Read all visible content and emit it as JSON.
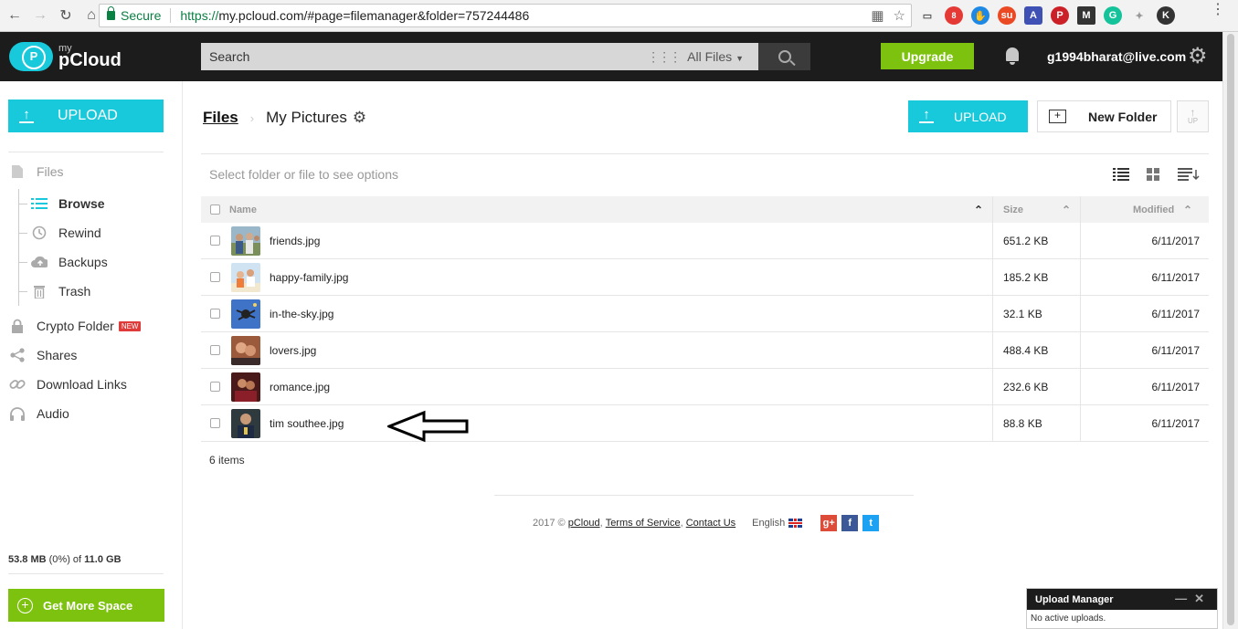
{
  "browser": {
    "secure_label": "Secure",
    "url_scheme": "https://",
    "url_rest": "my.pcloud.com/#page=filemanager&folder=757244486",
    "extension_badge": "8"
  },
  "header": {
    "logo_my": "my",
    "logo_name": "pCloud",
    "search_placeholder": "Search",
    "search_scope": "All Files",
    "upgrade_label": "Upgrade",
    "user_email": "g1994bharat@live.com"
  },
  "sidebar": {
    "upload_label": "UPLOAD",
    "files_label": "Files",
    "sub_items": [
      {
        "label": "Browse",
        "icon": "list-icon"
      },
      {
        "label": "Rewind",
        "icon": "history-icon"
      },
      {
        "label": "Backups",
        "icon": "cloud-upload-icon"
      },
      {
        "label": "Trash",
        "icon": "trash-icon"
      }
    ],
    "items": [
      {
        "label": "Crypto Folder",
        "icon": "lock-icon",
        "badge": "NEW"
      },
      {
        "label": "Shares",
        "icon": "share-icon"
      },
      {
        "label": "Download Links",
        "icon": "link-icon"
      },
      {
        "label": "Audio",
        "icon": "headphones-icon"
      }
    ],
    "storage_used": "53.8 MB",
    "storage_pct": " (0%) of ",
    "storage_total": "11.0 GB",
    "more_space_label": "Get More Space"
  },
  "main": {
    "breadcrumb_root": "Files",
    "breadcrumb_folder": "My Pictures",
    "upload_label": "UPLOAD",
    "new_folder_label": "New Folder",
    "up_label": "UP",
    "hint": "Select folder or file to see options",
    "columns": {
      "name": "Name",
      "size": "Size",
      "modified": "Modified"
    },
    "files": [
      {
        "name": "friends.jpg",
        "size": "651.2 KB",
        "modified": "6/11/2017"
      },
      {
        "name": "happy-family.jpg",
        "size": "185.2 KB",
        "modified": "6/11/2017"
      },
      {
        "name": "in-the-sky.jpg",
        "size": "32.1 KB",
        "modified": "6/11/2017"
      },
      {
        "name": "lovers.jpg",
        "size": "488.4 KB",
        "modified": "6/11/2017"
      },
      {
        "name": "romance.jpg",
        "size": "232.6 KB",
        "modified": "6/11/2017"
      },
      {
        "name": "tim southee.jpg",
        "size": "88.8 KB",
        "modified": "6/11/2017"
      }
    ],
    "items_count": "6 items"
  },
  "footer": {
    "year": "2017 ©",
    "brand": "pCloud",
    "terms": "Terms of Service",
    "contact": "Contact Us",
    "language": "English"
  },
  "upload_manager": {
    "title": "Upload Manager",
    "status": "No active uploads."
  },
  "colors": {
    "accent": "#17c9da",
    "green": "#7dc20f",
    "header_bg": "#1c1c1c"
  }
}
